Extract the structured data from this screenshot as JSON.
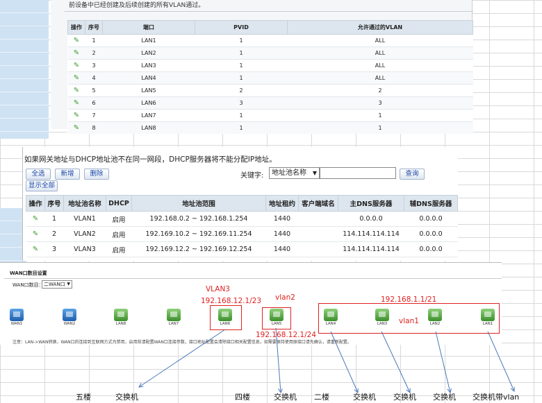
{
  "vlan_panel": {
    "note": "前设备中已经创建及后续创建的所有VLAN通过。",
    "headers": [
      "操作",
      "序号",
      "端口",
      "PVID",
      "允许通过的VLAN"
    ],
    "rows": [
      {
        "no": "1",
        "port": "LAN1",
        "pvid": "1",
        "vlan": "ALL"
      },
      {
        "no": "2",
        "port": "LAN2",
        "pvid": "1",
        "vlan": "ALL"
      },
      {
        "no": "3",
        "port": "LAN3",
        "pvid": "1",
        "vlan": "ALL"
      },
      {
        "no": "4",
        "port": "LAN4",
        "pvid": "1",
        "vlan": "ALL"
      },
      {
        "no": "5",
        "port": "LAN5",
        "pvid": "2",
        "vlan": "2"
      },
      {
        "no": "6",
        "port": "LAN6",
        "pvid": "3",
        "vlan": "3"
      },
      {
        "no": "7",
        "port": "LAN7",
        "pvid": "1",
        "vlan": "1"
      },
      {
        "no": "8",
        "port": "LAN8",
        "pvid": "1",
        "vlan": "1"
      }
    ]
  },
  "dhcp_panel": {
    "warning": "如果网关地址与DHCP地址池不在同一网段，DHCP服务器将不能分配IP地址。",
    "buttons": {
      "select_all": "全选",
      "add": "新增",
      "delete": "删除",
      "show_all": "显示全部",
      "search": "查询"
    },
    "keyword_label": "关键字:",
    "keyword_select": "地址池名称",
    "search_value": "",
    "headers": [
      "操作",
      "序号",
      "地址池名称",
      "DHCP",
      "地址池范围",
      "地址租约",
      "客户端域名",
      "主DNS服务器",
      "辅DNS服务器"
    ],
    "rows": [
      {
        "no": "1",
        "name": "VLAN1",
        "dhcp": "启用",
        "range": "192.168.0.2 ~ 192.168.1.254",
        "lease": "1440",
        "domain": "",
        "dns1": "0.0.0.0",
        "dns2": "0.0.0.0"
      },
      {
        "no": "2",
        "name": "VLAN2",
        "dhcp": "启用",
        "range": "192.169.10.2 ~ 192.169.11.254",
        "lease": "1440",
        "domain": "",
        "dns1": "114.114.114.114",
        "dns2": "0.0.0.0"
      },
      {
        "no": "3",
        "name": "VLAN3",
        "dhcp": "启用",
        "range": "192.169.12.2 ~ 192.169.12.254",
        "lease": "1440",
        "domain": "",
        "dns1": "114.114.114.114",
        "dns2": "0.0.0.0"
      }
    ]
  },
  "wan_panel": {
    "title": "WAN口数目设置",
    "count_label": "WAN口数目：",
    "count_value": "二WAN口",
    "ports": [
      "WAN1",
      "WAN2",
      "LAN8",
      "LAN7",
      "LAN6",
      "LAN5",
      "LAN4",
      "LAN3",
      "LAN2",
      "LAN1"
    ],
    "footer": "注意：LAN->WAN转换，WAN口的连接到互联网方式为禁用，启用前请配置WAN口连接参数，接口地址配置会清除接口相关配置信息，如需要保持使用原接口请先确认，请重新配置。"
  },
  "annotations": {
    "vlan3": "VLAN3",
    "vlan3_ip": "192.168.12.1/23",
    "vlan2": "vlan2",
    "vlan2_ip": "192.168.12.1/24",
    "vlan1_ip": "192.168.1.1/21",
    "vlan1": "vlan1"
  },
  "bottom_labels": [
    "五楼",
    "交换机",
    "四楼",
    "交换机",
    "二楼",
    "交换机",
    "交换机",
    "交换机",
    "交换机带vlan"
  ],
  "colors": {
    "accent_red": "#e02020",
    "header_bg": "#dde6ee",
    "lan_green": "#3c8f2c",
    "wan_blue": "#1e5fae"
  }
}
